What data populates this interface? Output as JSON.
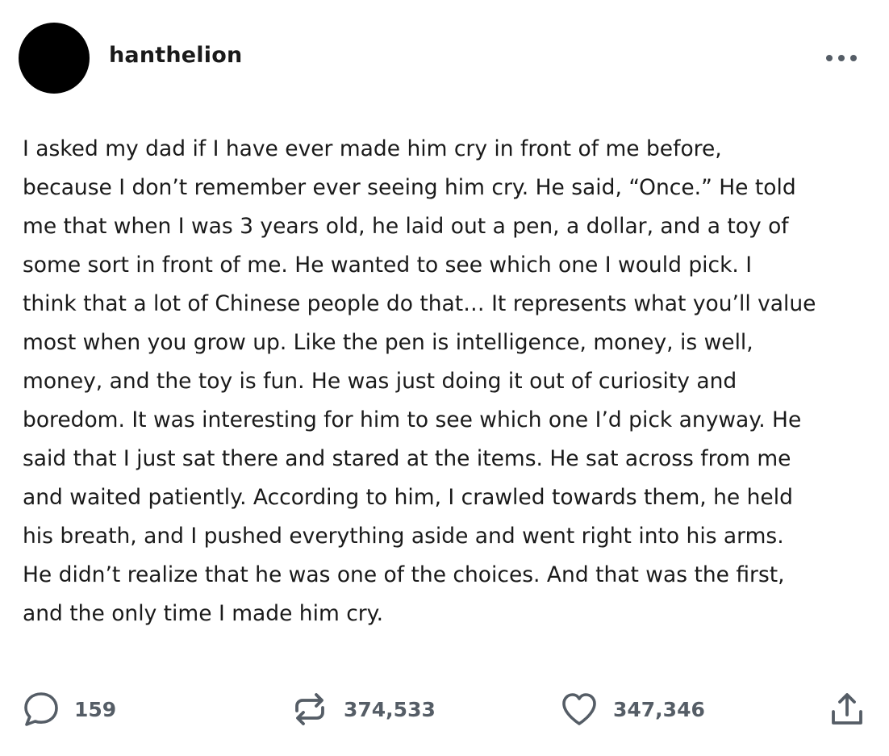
{
  "post": {
    "username": "hanthelion",
    "body_lines": [
      "I asked my dad if I have ever made him cry in front of me before,",
      "because I don’t remember ever seeing him cry. He said, “Once.” He told",
      "me that when I was 3 years old, he laid out a pen, a dollar, and a toy of",
      "some sort in front of me. He wanted to see which one I would pick. I",
      "think that a lot of Chinese people do that… It represents what you’ll value",
      "most when you grow up. Like the pen is intelligence, money, is well,",
      "money, and the toy is fun. He was just doing it out of curiosity and",
      "boredom. It was interesting for him to see which one I’d pick anyway. He",
      "said that I just sat there and stared at the items. He sat across from me",
      "and waited patiently. According to him, I crawled towards them, he held",
      "his breath, and I pushed everything aside and went right into his arms.",
      "He didn’t realize that he was one of the choices. And that was the first,",
      "and the only time I made him cry."
    ]
  },
  "footer": {
    "comments_count": "159",
    "reblogs_count": "374,533",
    "likes_count": "347,346"
  },
  "icons": {
    "more": "more-horizontal-icon",
    "comment": "comment-bubble-icon",
    "reblog": "reblog-icon",
    "like": "heart-icon",
    "share": "share-icon"
  },
  "colors": {
    "text": "#1a1a1a",
    "icon": "#555d66",
    "avatar": "#000000"
  }
}
